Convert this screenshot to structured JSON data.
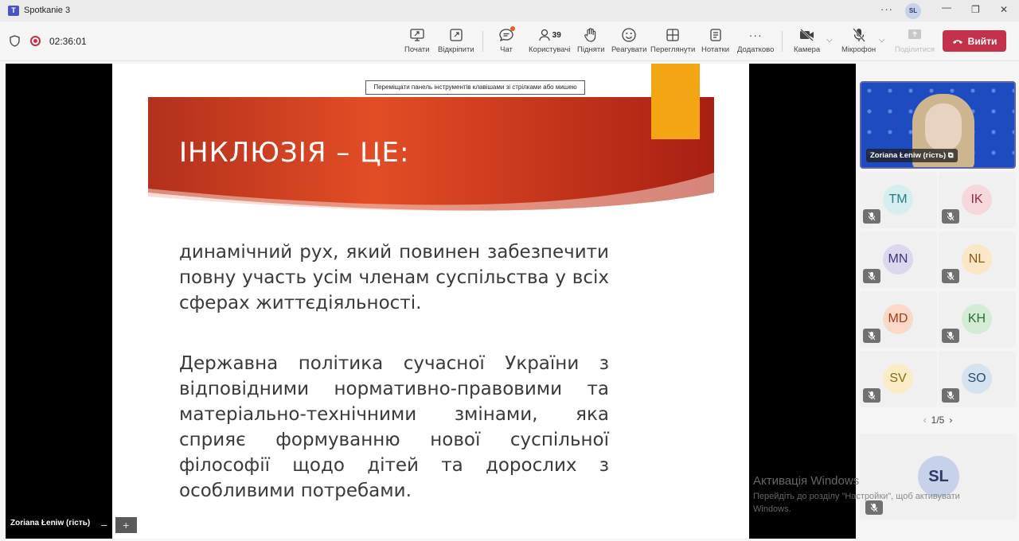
{
  "window": {
    "title": "Spotkanie 3",
    "user_initials": "SL"
  },
  "meeting": {
    "timer": "02:36:01"
  },
  "toolbar": {
    "start": "Почати",
    "detach": "Відкріпити",
    "chat": "Чат",
    "people": "Користувачі",
    "people_count": "39",
    "raise": "Підняти",
    "react": "Реагувати",
    "view": "Переглянути",
    "notes": "Нотатки",
    "more": "Додатково",
    "camera": "Камера",
    "mic": "Мікрофон",
    "share": "Поділитися",
    "leave": "Вийти"
  },
  "slide": {
    "hint": "Переміщати панель інструментів клавішами зі стрілками або мишею",
    "title": "ІНКЛЮЗІЯ – ЦЕ:",
    "p1": "динамічний рух, який повинен забезпечити повну участь усім членам суспільства у всіх сферах життєдіяльності.",
    "p2": "Державна політика сучасної України з відповідними нормативно-правовими та матеріально-технічними змінами, яка сприяє формуванню нової суспільної філософії щодо дітей та дорослих з особливими потребами."
  },
  "stage": {
    "presenter_name": "Zoriana Łeniw (гість)"
  },
  "participants": {
    "main_name": "Zoriana Łeniw (гість)",
    "tiles": [
      {
        "initials": "TM",
        "bg": "#d6eef0",
        "fg": "#2b7a82"
      },
      {
        "initials": "IK",
        "bg": "#f6d7db",
        "fg": "#9a2a3b"
      },
      {
        "initials": "MN",
        "bg": "#dcd6ef",
        "fg": "#3d3576"
      },
      {
        "initials": "NL",
        "bg": "#fbe6c8",
        "fg": "#8a5a12"
      },
      {
        "initials": "MD",
        "bg": "#fbd8c8",
        "fg": "#a33a14"
      },
      {
        "initials": "KH",
        "bg": "#d4ecd6",
        "fg": "#2d6b35"
      },
      {
        "initials": "SV",
        "bg": "#faecc7",
        "fg": "#8a6a0f"
      },
      {
        "initials": "SO",
        "bg": "#d5e2ef",
        "fg": "#2b4a6e"
      }
    ],
    "page": "1/5",
    "self_initials": "SL"
  },
  "watermark": {
    "title": "Активація Windows",
    "line1": "Перейдіть до розділу \"Настройки\", щоб активувати",
    "line2": "Windows."
  },
  "colors": {
    "leave": "#c4314b",
    "banner_start": "#e24d25",
    "banner_end": "#a81f12",
    "accent_square": "#f3a514"
  },
  "icons": [
    "teams-logo-icon",
    "more-icon",
    "minimize-icon",
    "maximize-icon",
    "close-icon",
    "shield-icon",
    "record-icon",
    "share-screen-icon",
    "popout-icon",
    "chat-icon",
    "people-icon",
    "hand-icon",
    "emoji-icon",
    "view-icon",
    "notes-icon",
    "more-icon",
    "camera-off-icon",
    "mic-off-icon",
    "share-icon",
    "phone-icon"
  ]
}
